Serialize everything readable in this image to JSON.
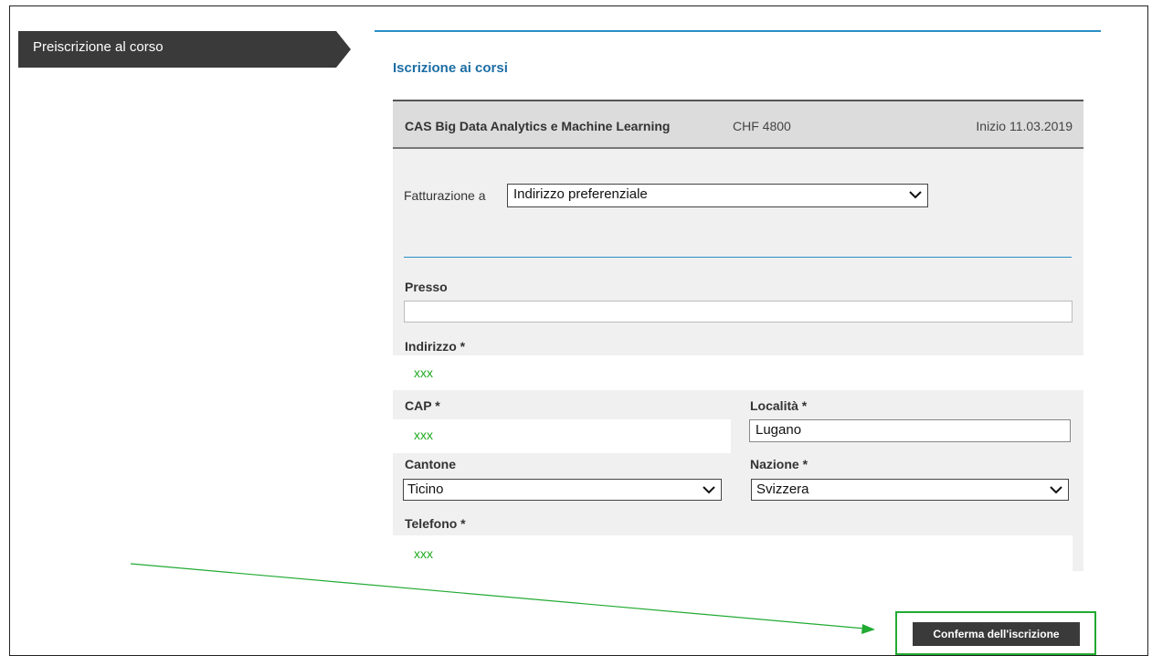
{
  "sidebar": {
    "tab_label": "Preiscrizione al corso"
  },
  "main": {
    "section_title": "Iscrizione ai corsi",
    "course": {
      "name": "CAS Big Data Analytics e Machine Learning",
      "price": "CHF 4800",
      "start": "Inizio 11.03.2019"
    },
    "billing": {
      "label": "Fatturazione a",
      "selected": "Indirizzo preferenziale"
    },
    "form": {
      "presso_label": "Presso",
      "presso_value": "",
      "indirizzo_label": "Indirizzo *",
      "indirizzo_value": "xxx",
      "cap_label": "CAP *",
      "cap_value": "xxx",
      "localita_label": "Località *",
      "localita_value": "Lugano",
      "cantone_label": "Cantone",
      "cantone_selected": "Ticino",
      "nazione_label": "Nazione *",
      "nazione_selected": "Svizzera",
      "telefono_label": "Telefono *",
      "telefono_value": "xxx"
    },
    "confirm_label": "Conferma dell'iscrizione"
  },
  "colors": {
    "accent_blue": "#2a8fc4",
    "highlight_green": "#22aa33",
    "redacted_text_green": "#1faa1f",
    "dark_tab": "#3a3a3a"
  }
}
